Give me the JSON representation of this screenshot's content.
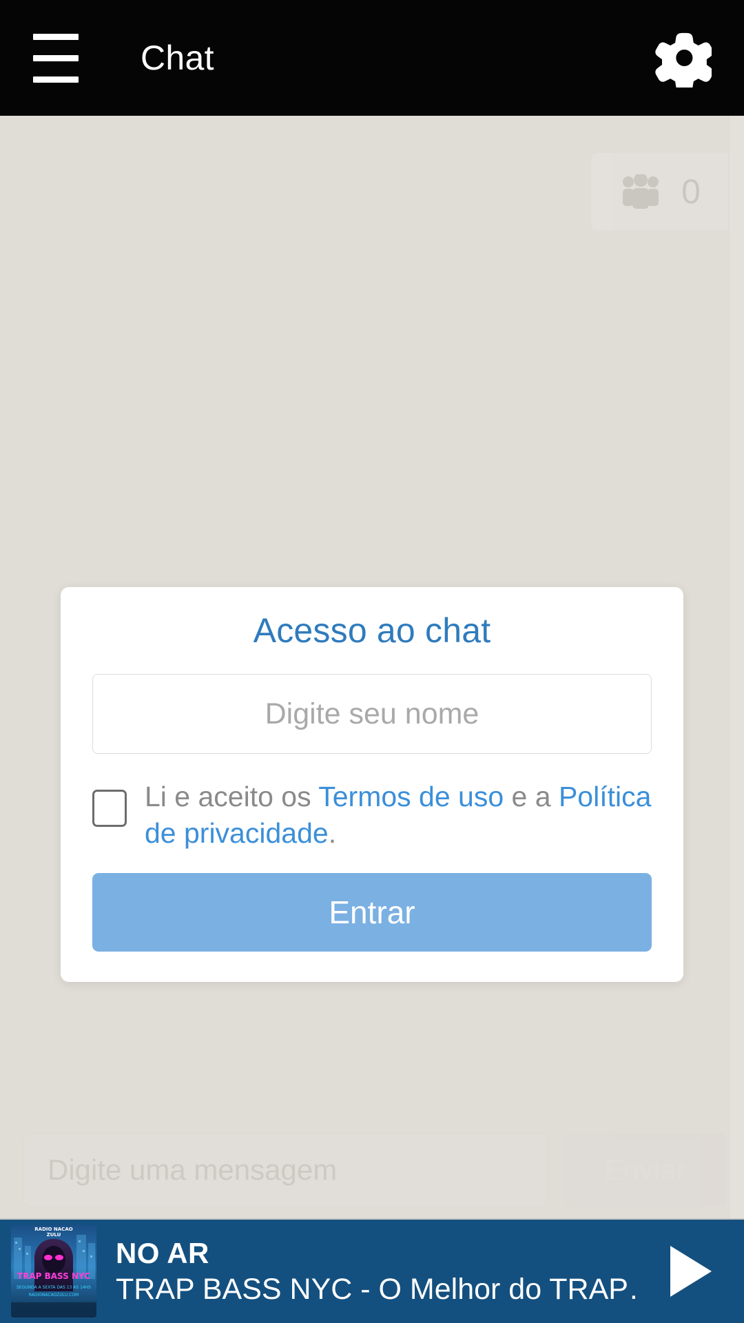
{
  "header": {
    "menu_icon": "hamburger-menu-icon",
    "title": "Chat",
    "settings_icon": "gear-icon"
  },
  "chat": {
    "users_icon": "people-group-icon",
    "users_count": "0",
    "message_input_placeholder": "Digite uma mensagem",
    "send_label": "Enviar"
  },
  "modal": {
    "title": "Acesso ao chat",
    "name_placeholder": "Digite seu nome",
    "name_value": "",
    "terms_prefix": "Li e aceito os ",
    "terms_link": "Termos de uso",
    "terms_middle": " e a ",
    "privacy_link": "Política de privacidade",
    "terms_suffix": ".",
    "checkbox_checked": false,
    "submit_label": "Entrar"
  },
  "player": {
    "status": "NO AR",
    "track": "TRAP BASS NYC - O Melhor do TRAP…",
    "play_icon": "play-icon",
    "artwork_alt": "TRAP BASS NYC"
  },
  "colors": {
    "header_bg": "#050505",
    "chat_bg": "#e0dcd6",
    "modal_bg": "#ffffff",
    "accent_blue": "#2f7bbd",
    "link_blue": "#3b8fd9",
    "button_blue": "#7bb0e2",
    "player_bg": "#14507f",
    "muted_text": "#8a8a8a"
  }
}
